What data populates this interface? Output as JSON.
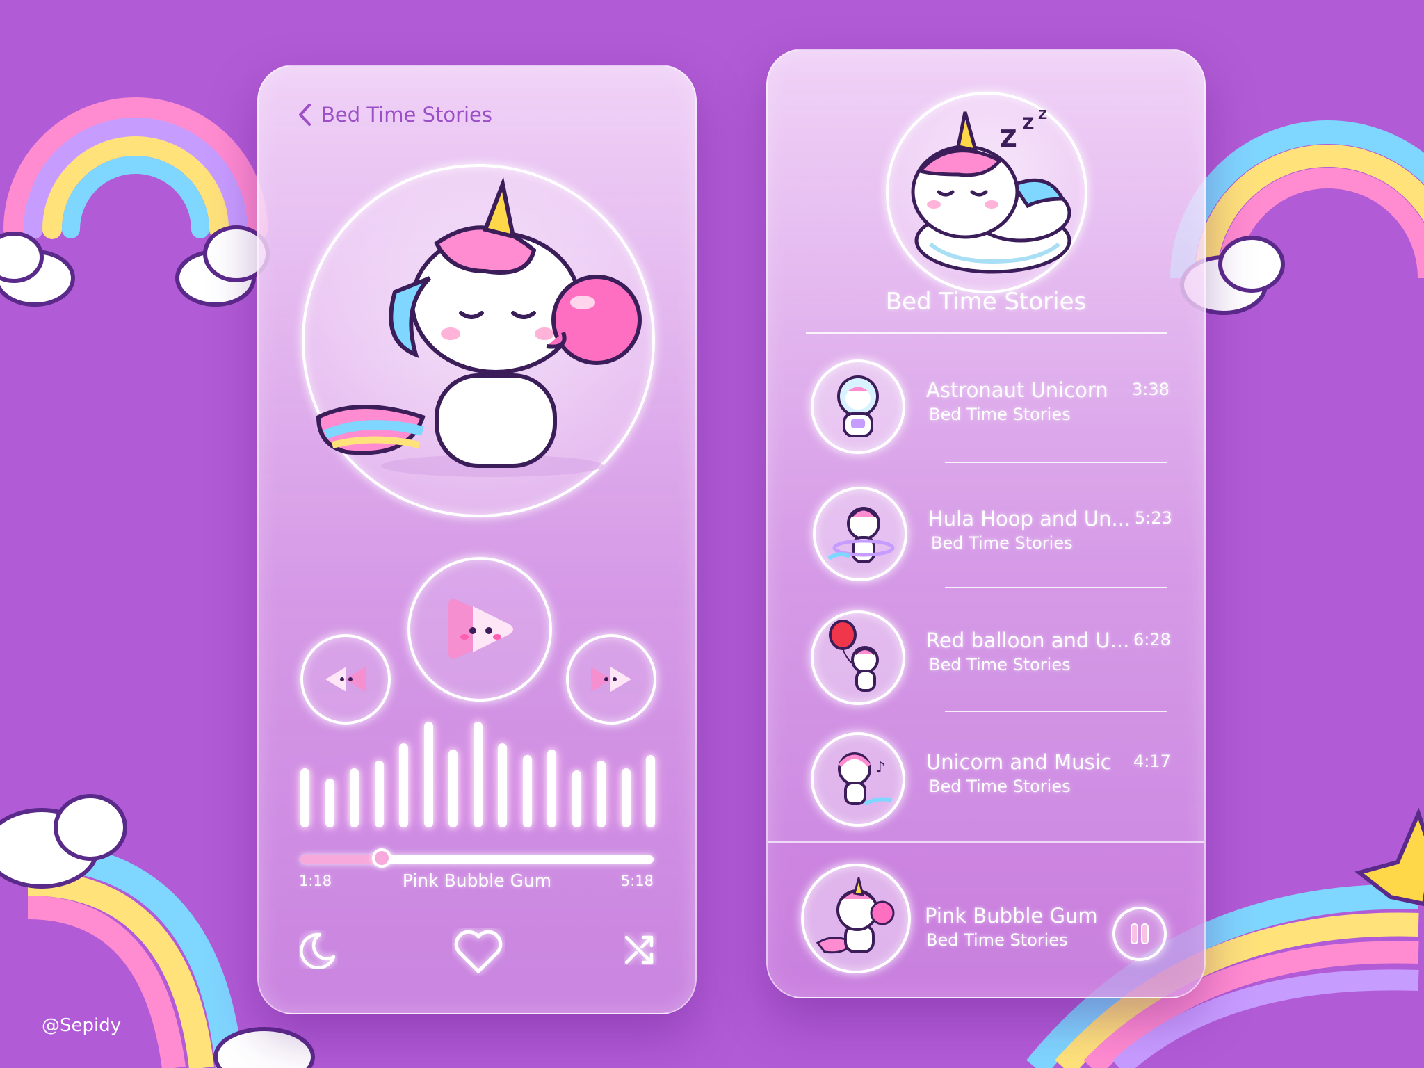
{
  "player": {
    "header_title": "Bed Time Stories",
    "now_playing": {
      "title": "Pink Bubble Gum",
      "elapsed": "1:18",
      "duration": "5:18",
      "progress": 0.23
    },
    "equalizer_levels": [
      0.55,
      0.45,
      0.55,
      0.62,
      0.78,
      0.98,
      0.72,
      0.98,
      0.78,
      0.67,
      0.72,
      0.53,
      0.62,
      0.55,
      0.67
    ]
  },
  "playlist": {
    "header_title": "Bed Time Stories",
    "tracks": [
      {
        "title": "Astronaut Unicorn",
        "subtitle": "Bed Time Stories",
        "duration": "3:38"
      },
      {
        "title": "Hula Hoop and Un...",
        "subtitle": "Bed Time Stories",
        "duration": "5:23"
      },
      {
        "title": "Red balloon and U...",
        "subtitle": "Bed Time Stories",
        "duration": "6:28"
      },
      {
        "title": "Unicorn and Music",
        "subtitle": "Bed Time Stories",
        "duration": "4:17"
      }
    ],
    "mini_player": {
      "title": "Pink Bubble Gum",
      "subtitle": "Bed Time Stories"
    }
  },
  "watermark": "@Sepidy",
  "colors": {
    "background": "#b25bd6",
    "accent_pink": "#f58fd0",
    "title_purple": "#9b4fc6"
  },
  "icons": [
    "back-chevron-icon",
    "play-icon",
    "rewind-icon",
    "fast-forward-icon",
    "moon-icon",
    "heart-icon",
    "shuffle-icon",
    "pause-icon"
  ]
}
